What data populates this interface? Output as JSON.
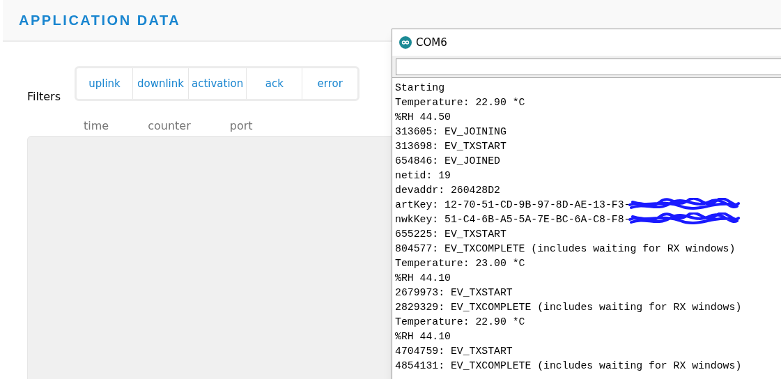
{
  "page": {
    "title": "APPLICATION DATA"
  },
  "filters": {
    "label": "Filters",
    "options": [
      {
        "label": "uplink"
      },
      {
        "label": "downlink"
      },
      {
        "label": "activation"
      },
      {
        "label": "ack"
      },
      {
        "label": "error"
      }
    ]
  },
  "table": {
    "columns": [
      "time",
      "counter",
      "port"
    ]
  },
  "serial_monitor": {
    "title": "COM6",
    "lines": [
      {
        "text": "Starting"
      },
      {
        "text": "Temperature: 22.90 *C"
      },
      {
        "text": "%RH 44.50"
      },
      {
        "text": "313605: EV_JOINING"
      },
      {
        "text": "313698: EV_TXSTART"
      },
      {
        "text": "654846: EV_JOINED"
      },
      {
        "text": "netid: 19"
      },
      {
        "text": "devaddr: 260428D2"
      },
      {
        "text": "artKey: 12-70-51-CD-9B-97-8D-AE-13-F3-",
        "redacted": true
      },
      {
        "text": "nwkKey: 51-C4-6B-A5-5A-7E-BC-6A-C8-F8-",
        "redacted": true
      },
      {
        "text": "655225: EV_TXSTART"
      },
      {
        "text": "804577: EV_TXCOMPLETE (includes waiting for RX windows)"
      },
      {
        "text": "Temperature: 23.00 *C"
      },
      {
        "text": "%RH 44.10"
      },
      {
        "text": "2679973: EV_TXSTART"
      },
      {
        "text": "2829329: EV_TXCOMPLETE (includes waiting for RX windows)"
      },
      {
        "text": "Temperature: 22.90 *C"
      },
      {
        "text": "%RH 44.10"
      },
      {
        "text": "4704759: EV_TXSTART"
      },
      {
        "text": "4854131: EV_TXCOMPLETE (includes waiting for RX windows)"
      }
    ]
  }
}
